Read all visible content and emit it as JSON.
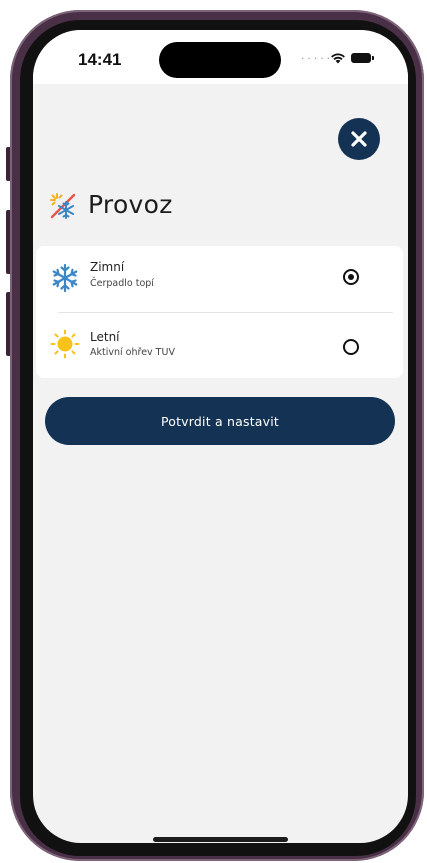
{
  "status_bar": {
    "time": "14:41",
    "signal_dots": ".....",
    "wifi_icon": "wifi-icon",
    "battery_icon": "battery-icon"
  },
  "header": {
    "title": "Provoz",
    "icon": "snow-sun-icon",
    "close_icon": "close-icon"
  },
  "options": [
    {
      "label": "Zimní",
      "subtitle": "Čerpadlo topí",
      "icon": "snowflake-icon",
      "selected": true
    },
    {
      "label": "Letní",
      "subtitle": "Aktivní ohřev TUV",
      "icon": "sun-icon",
      "selected": false
    }
  ],
  "confirm_button": {
    "label": "Potvrdit a nastavit"
  },
  "colors": {
    "primary": "#143354",
    "background": "#f2f2f2",
    "card": "#ffffff",
    "snowflake": "#3a87c7",
    "sun": "#f7c21a",
    "frame": "#4a3046"
  }
}
